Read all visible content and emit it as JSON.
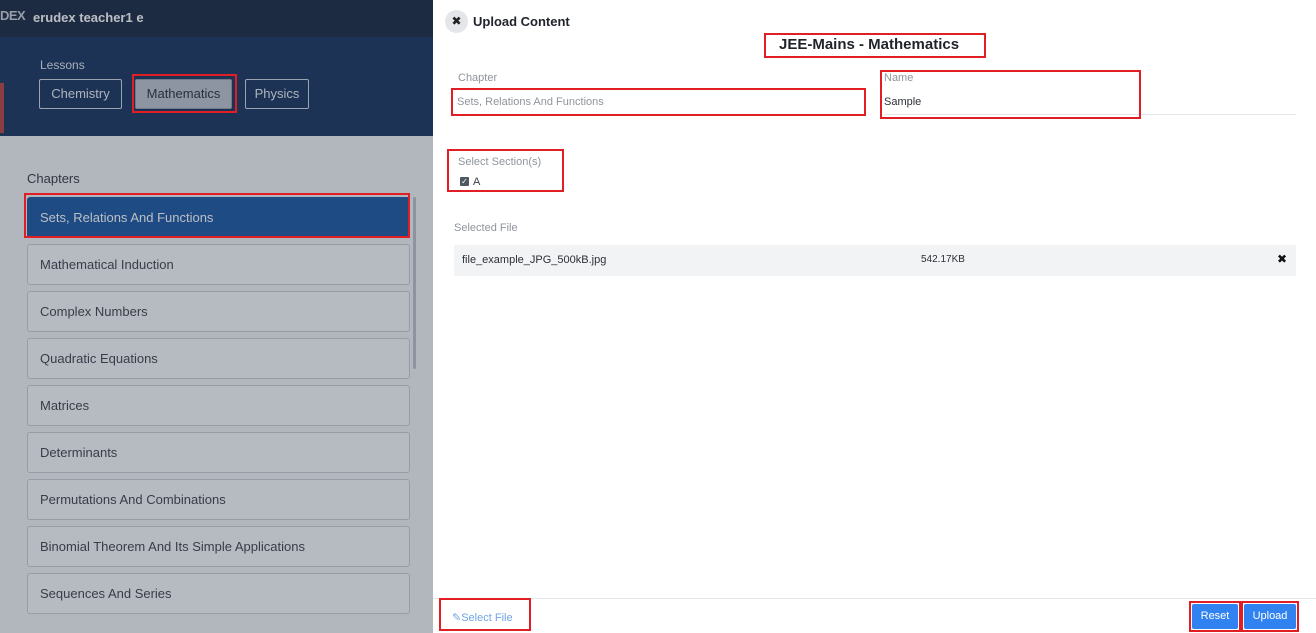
{
  "background_app": {
    "logo": "DEX",
    "user_name": "erudex teacher1 e",
    "lessons_label": "Lessons",
    "subjects": [
      {
        "label": "Chemistry",
        "active": false
      },
      {
        "label": "Mathematics",
        "active": true
      },
      {
        "label": "Physics",
        "active": false
      }
    ],
    "chapters_label": "Chapters",
    "chapters": [
      {
        "label": "Sets, Relations And Functions",
        "active": true
      },
      {
        "label": "Mathematical Induction",
        "active": false
      },
      {
        "label": "Complex Numbers",
        "active": false
      },
      {
        "label": "Quadratic Equations",
        "active": false
      },
      {
        "label": "Matrices",
        "active": false
      },
      {
        "label": "Determinants",
        "active": false
      },
      {
        "label": "Permutations And Combinations",
        "active": false
      },
      {
        "label": "Binomial Theorem And Its Simple Applications",
        "active": false
      },
      {
        "label": "Sequences And Series",
        "active": false
      }
    ]
  },
  "panel": {
    "close_icon": "close-icon",
    "title": "Upload Content",
    "course_title": "JEE-Mains - Mathematics",
    "chapter": {
      "label": "Chapter",
      "value": "Sets, Relations And Functions"
    },
    "name": {
      "label": "Name",
      "value": "Sample"
    },
    "sections": {
      "label": "Select Section(s)",
      "items": [
        {
          "label": "A",
          "checked": true
        }
      ]
    },
    "selected_file": {
      "label": "Selected File",
      "file_name": "file_example_JPG_500kB.jpg",
      "file_size": "542.17KB"
    },
    "footer": {
      "select_file_label": "Select File",
      "reset_label": "Reset",
      "upload_label": "Upload"
    }
  },
  "colors": {
    "annotation": "#e01e24",
    "primary_button": "#2f82f0",
    "active_chapter": "#0f4f9c",
    "topbar": "#0b1e36"
  }
}
